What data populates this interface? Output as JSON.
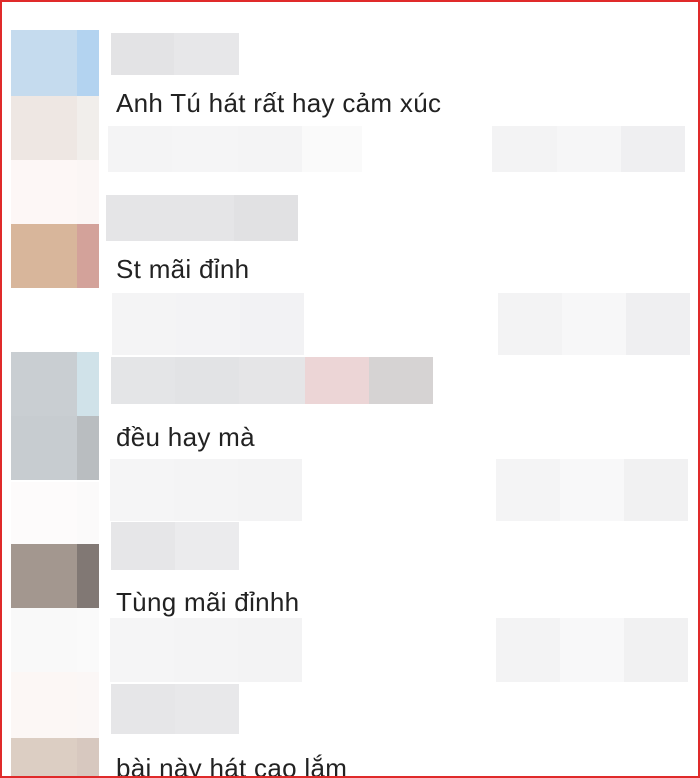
{
  "comments": [
    {
      "text": "Anh Tú hát rất hay cảm xúc"
    },
    {
      "text": "St mãi đỉnh"
    },
    {
      "text": "đều hay mà"
    },
    {
      "text": "Tùng mãi đỉnhh"
    },
    {
      "text": "bài này hát cao lắm"
    }
  ],
  "colors": {
    "border": "#e02a2a",
    "text": "#222222"
  }
}
